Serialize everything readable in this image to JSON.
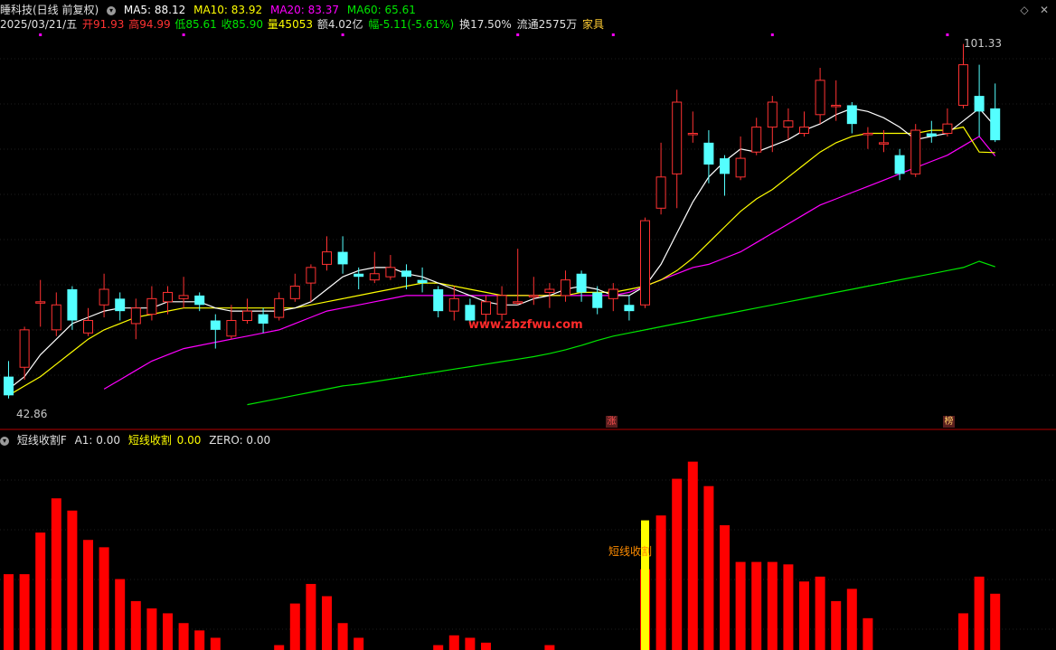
{
  "header": {
    "title": "睡科技(日线 前复权)",
    "ma5": "MA5: 88.12",
    "ma10": "MA10: 83.92",
    "ma20": "MA20: 83.37",
    "ma60": "MA60: 65.61",
    "date": "2025/03/21/五",
    "open": "开91.93",
    "high": "高94.99",
    "low": "低85.61",
    "close": "收85.90",
    "volume": "量45053",
    "amount": "额4.02亿",
    "change": "幅-5.11(-5.61%)",
    "turnover": "换17.50%",
    "float": "流通2575万",
    "industry": "家具"
  },
  "colors": {
    "up": "#ff3232",
    "down": "#54ffff",
    "ma5": "#ffffff",
    "ma10": "#ffff00",
    "ma20": "#ff00ff",
    "ma60": "#00e600",
    "watermark": "#ff2a2a",
    "bar": "#ff0000",
    "bar_highlight": "#ffff00"
  },
  "price_labels": {
    "high_label": "101.33",
    "low_label": "42.86"
  },
  "markers": {
    "zhang": "涨",
    "bang": "榜"
  },
  "watermark": "www.zbzfwu.com",
  "indicator": {
    "name": "短线收割F",
    "a1": "A1: 0.00",
    "signal_name": "短线收割",
    "signal_value": "0.00",
    "zero": "ZERO: 0.00",
    "bar_label": "短线收割"
  },
  "chart_data": {
    "type": "candlestick",
    "price_range": [
      42,
      102
    ],
    "candles": [
      [
        48.0,
        45.0,
        50.5,
        44.5
      ],
      [
        49.5,
        55.5,
        56.0,
        47.5
      ],
      [
        60.0,
        60.0,
        63.5,
        56.0
      ],
      [
        55.5,
        59.5,
        61.5,
        54.5
      ],
      [
        62.0,
        57.0,
        62.5,
        55.5
      ],
      [
        55.0,
        57.0,
        59.0,
        54.5
      ],
      [
        59.5,
        62.0,
        64.5,
        57.5
      ],
      [
        60.5,
        58.5,
        61.5,
        57.0
      ],
      [
        56.5,
        59.0,
        60.5,
        54.0
      ],
      [
        58.0,
        60.5,
        62.5,
        57.0
      ],
      [
        60.0,
        61.5,
        62.5,
        58.0
      ],
      [
        60.5,
        61.0,
        64.0,
        59.0
      ],
      [
        61.0,
        59.5,
        61.5,
        58.5
      ],
      [
        57.0,
        55.5,
        58.0,
        52.5
      ],
      [
        54.5,
        57.0,
        59.5,
        54.0
      ],
      [
        57.0,
        58.5,
        60.5,
        56.5
      ],
      [
        58.0,
        56.5,
        59.0,
        55.0
      ],
      [
        57.5,
        60.5,
        61.5,
        57.0
      ],
      [
        60.5,
        62.5,
        64.5,
        60.0
      ],
      [
        63.0,
        65.5,
        66.0,
        60.0
      ],
      [
        66.0,
        68.0,
        70.5,
        65.0
      ],
      [
        68.0,
        66.0,
        70.5,
        64.5
      ],
      [
        64.5,
        64.0,
        65.5,
        62.0
      ],
      [
        63.5,
        64.5,
        68.0,
        63.0
      ],
      [
        64.0,
        65.5,
        67.5,
        63.5
      ],
      [
        65.0,
        64.0,
        66.0,
        62.0
      ],
      [
        63.5,
        63.0,
        65.5,
        61.5
      ],
      [
        62.0,
        58.5,
        62.5,
        57.5
      ],
      [
        58.5,
        60.5,
        62.5,
        57.0
      ],
      [
        59.5,
        57.0,
        60.5,
        56.5
      ],
      [
        58.0,
        60.0,
        61.0,
        56.5
      ],
      [
        58.0,
        61.0,
        62.5,
        57.0
      ],
      [
        60.0,
        60.0,
        68.5,
        59.5
      ],
      [
        61.0,
        61.0,
        64.0,
        59.5
      ],
      [
        61.5,
        62.0,
        63.0,
        59.0
      ],
      [
        61.0,
        63.5,
        65.0,
        60.0
      ],
      [
        64.5,
        61.5,
        65.0,
        60.0
      ],
      [
        61.5,
        59.0,
        62.5,
        58.0
      ],
      [
        60.5,
        62.0,
        63.0,
        58.5
      ],
      [
        59.5,
        58.5,
        61.0,
        57.0
      ],
      [
        59.5,
        73.0,
        73.5,
        59.0
      ],
      [
        75.0,
        80.0,
        85.5,
        74.0
      ],
      [
        80.5,
        92.0,
        94.0,
        75.0
      ],
      [
        87.0,
        87.0,
        90.5,
        85.5
      ],
      [
        85.5,
        82.0,
        87.5,
        79.0
      ],
      [
        83.0,
        80.5,
        83.5,
        77.0
      ],
      [
        80.0,
        83.0,
        86.5,
        79.5
      ],
      [
        84.0,
        88.0,
        89.5,
        83.5
      ],
      [
        88.0,
        92.0,
        93.0,
        84.0
      ],
      [
        88.0,
        89.0,
        91.0,
        86.0
      ],
      [
        87.0,
        88.0,
        90.5,
        86.5
      ],
      [
        90.0,
        95.5,
        97.5,
        88.5
      ],
      [
        91.5,
        91.5,
        95.5,
        89.0
      ],
      [
        91.5,
        88.5,
        92.0,
        87.0
      ],
      [
        87.0,
        87.0,
        88.0,
        84.5
      ],
      [
        85.5,
        85.5,
        87.5,
        84.0
      ],
      [
        83.5,
        80.5,
        84.5,
        79.5
      ],
      [
        80.5,
        87.5,
        88.5,
        80.0
      ],
      [
        87.0,
        86.5,
        89.0,
        85.5
      ],
      [
        87.0,
        88.5,
        91.0,
        86.5
      ],
      [
        91.5,
        98.0,
        101.33,
        91.0
      ],
      [
        93.0,
        90.5,
        98.0,
        86.5
      ],
      [
        91.0,
        85.9,
        94.99,
        85.61
      ]
    ],
    "ma5": [
      46.0,
      48.0,
      51.5,
      54.0,
      56.5,
      57.5,
      58.5,
      59.0,
      59.0,
      59.0,
      60.0,
      60.0,
      60.0,
      59.0,
      58.5,
      58.5,
      58.5,
      58.5,
      59.0,
      60.0,
      62.0,
      64.0,
      65.0,
      65.5,
      65.5,
      64.5,
      64.0,
      63.0,
      62.0,
      61.0,
      60.0,
      59.5,
      59.5,
      60.5,
      61.0,
      62.0,
      62.5,
      62.0,
      61.0,
      61.0,
      62.5,
      66.0,
      71.0,
      76.0,
      80.0,
      82.5,
      84.5,
      84.0,
      85.0,
      86.0,
      87.5,
      88.5,
      90.0,
      91.0,
      90.5,
      89.5,
      88.0,
      86.0,
      86.5,
      87.0,
      89.0,
      91.0,
      88.12
    ],
    "ma10": [
      45.0,
      46.5,
      48.0,
      50.0,
      52.0,
      54.0,
      55.5,
      56.5,
      57.5,
      58.0,
      58.5,
      59.0,
      59.0,
      59.0,
      59.0,
      59.0,
      59.0,
      59.0,
      59.0,
      59.5,
      60.0,
      60.5,
      61.0,
      61.5,
      62.0,
      62.5,
      63.0,
      63.0,
      62.5,
      62.0,
      61.5,
      61.0,
      61.0,
      61.0,
      61.0,
      61.0,
      61.5,
      61.5,
      61.5,
      62.0,
      62.5,
      63.5,
      65.0,
      67.0,
      69.5,
      72.0,
      74.5,
      76.5,
      78.0,
      80.0,
      82.0,
      84.0,
      85.5,
      86.5,
      87.0,
      87.0,
      87.0,
      87.0,
      87.5,
      87.5,
      88.0,
      84.0,
      83.92
    ],
    "ma20": [
      null,
      null,
      null,
      null,
      null,
      null,
      46.0,
      47.5,
      49.0,
      50.5,
      51.5,
      52.5,
      53.0,
      53.5,
      54.0,
      54.5,
      55.0,
      55.5,
      56.5,
      57.5,
      58.5,
      59.0,
      59.5,
      60.0,
      60.5,
      61.0,
      61.0,
      61.0,
      61.0,
      61.0,
      61.0,
      61.0,
      61.0,
      61.0,
      61.0,
      61.0,
      61.0,
      61.0,
      61.0,
      61.5,
      62.5,
      63.5,
      64.5,
      65.5,
      66.0,
      67.0,
      68.0,
      69.5,
      71.0,
      72.5,
      74.0,
      75.5,
      76.5,
      77.5,
      78.5,
      79.5,
      80.5,
      81.5,
      82.5,
      83.5,
      85.0,
      86.5,
      83.37
    ],
    "ma60": [
      null,
      null,
      null,
      null,
      null,
      null,
      null,
      null,
      null,
      null,
      null,
      null,
      null,
      null,
      null,
      43.5,
      44.0,
      44.5,
      45.0,
      45.5,
      46.0,
      46.5,
      46.8,
      47.2,
      47.6,
      48.0,
      48.4,
      48.8,
      49.2,
      49.6,
      50.0,
      50.4,
      50.8,
      51.2,
      51.7,
      52.3,
      53.0,
      53.8,
      54.5,
      55.0,
      55.5,
      56.0,
      56.5,
      57.0,
      57.5,
      58.0,
      58.5,
      59.0,
      59.5,
      60.0,
      60.5,
      61.0,
      61.5,
      62.0,
      62.5,
      63.0,
      63.5,
      64.0,
      64.5,
      65.0,
      65.5,
      66.5,
      65.61
    ],
    "indicator_bars": [
      0.31,
      0.31,
      0.48,
      0.62,
      0.57,
      0.45,
      0.42,
      0.29,
      0.2,
      0.17,
      0.15,
      0.11,
      0.08,
      0.05,
      0.0,
      0.0,
      0.0,
      0.02,
      0.19,
      0.27,
      0.22,
      0.11,
      0.05,
      0.0,
      0.0,
      0.0,
      0.0,
      0.02,
      0.06,
      0.05,
      0.03,
      0.0,
      0.0,
      0.0,
      0.02,
      0.0,
      0.0,
      0.0,
      0.0,
      0.0,
      0.33,
      0.55,
      0.7,
      0.77,
      0.67,
      0.51,
      0.36,
      0.36,
      0.36,
      0.35,
      0.28,
      0.3,
      0.2,
      0.25,
      0.13,
      0.0,
      0.0,
      0.0,
      0.0,
      0.0,
      0.15,
      0.3,
      0.23
    ],
    "indicator_highlight_index": 40,
    "indicator_highlight_value": 0.53,
    "indicator_range": [
      0,
      0.85
    ]
  }
}
